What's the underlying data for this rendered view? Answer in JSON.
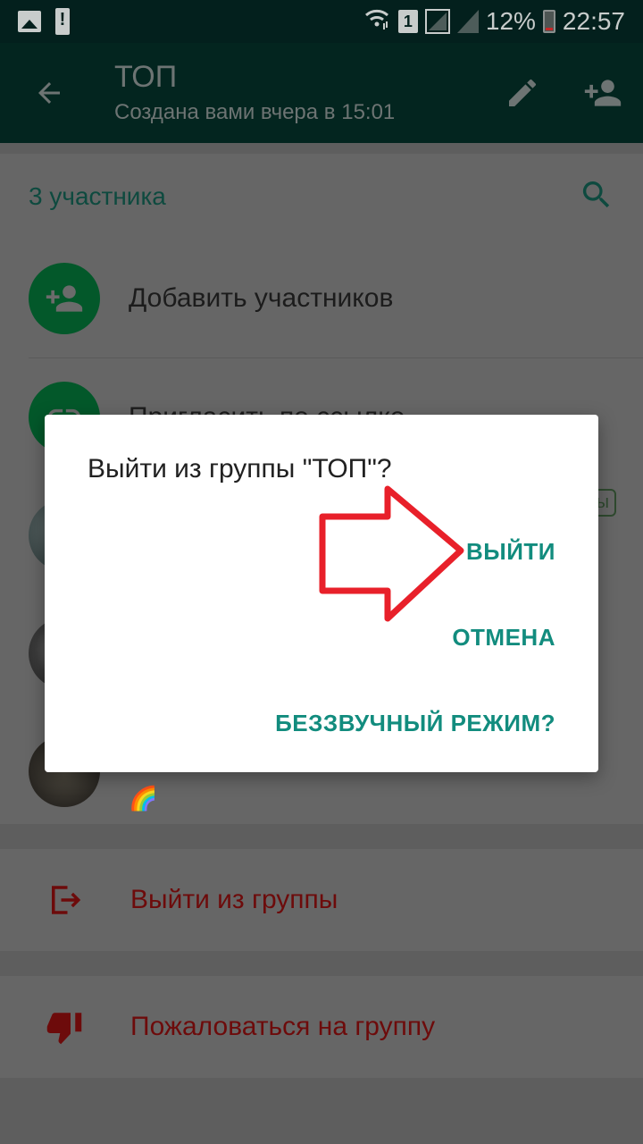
{
  "status_bar": {
    "left_icons": [
      "image-icon",
      "alert-icon"
    ],
    "sim_label": "1",
    "battery_percent": "12%",
    "time": "22:57"
  },
  "app_bar": {
    "title": "ТОП",
    "subtitle": "Создана вами вчера в 15:01",
    "actions": [
      "edit-icon",
      "add-participant-icon"
    ]
  },
  "participants": {
    "header": "3 участника",
    "add_label": "Добавить участников",
    "invite_label": "Пригласить по ссылке",
    "members": [
      {
        "avatar": "avatar-1",
        "badge": "ы"
      },
      {
        "avatar": "avatar-2"
      },
      {
        "avatar": "avatar-3",
        "status_emoji": "🌈"
      }
    ]
  },
  "actions": {
    "exit_group": "Выйти из группы",
    "report_group": "Пожаловаться на группу"
  },
  "dialog": {
    "message": "Выйти из группы \"ТОП\"?",
    "buttons": {
      "exit": "ВЫЙТИ",
      "cancel": "ОТМЕНА",
      "mute": "БЕЗЗВУЧНЫЙ РЕЖИМ?"
    }
  },
  "colors": {
    "accent": "#128c7e",
    "app_bar": "#075e54",
    "danger": "#c62828",
    "annotation": "#e8202a"
  }
}
